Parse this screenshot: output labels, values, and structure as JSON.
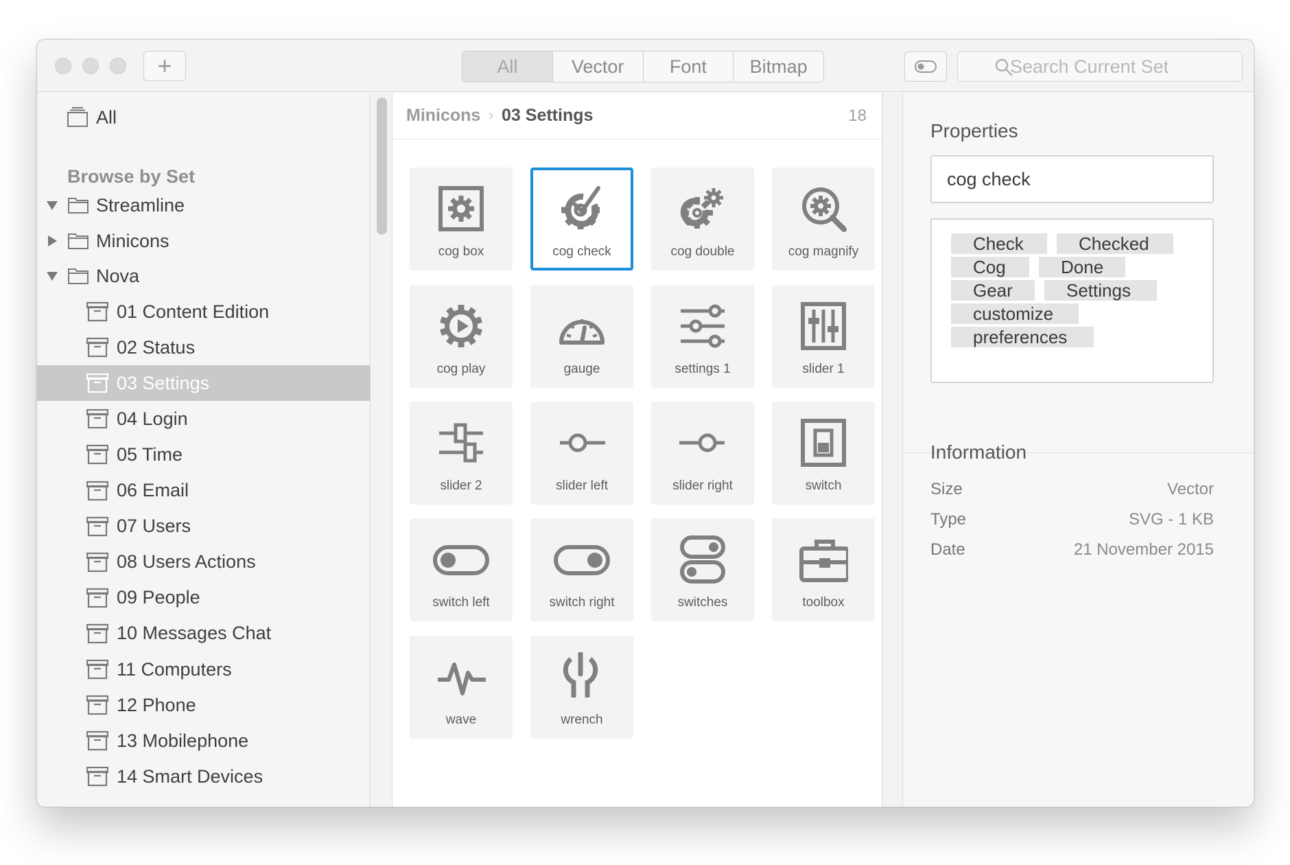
{
  "toolbar": {
    "add_label": "+",
    "filters": [
      "All",
      "Vector",
      "Font",
      "Bitmap"
    ],
    "active_filter": "All",
    "search_placeholder": "Search Current Set"
  },
  "sidebar": {
    "all_label": "All",
    "section_heading": "Browse by Set",
    "sets": [
      {
        "label": "Streamline",
        "expanded": true
      },
      {
        "label": "Minicons",
        "expanded": false
      },
      {
        "label": "Nova",
        "expanded": true
      }
    ],
    "nova_items": [
      "01 Content Edition",
      "02 Status",
      "03 Settings",
      "04 Login",
      "05 Time",
      "06 Email",
      "07 Users",
      "08 Users Actions",
      "09 People",
      "10 Messages Chat",
      "11 Computers",
      "12 Phone",
      "13 Mobilephone",
      "14 Smart Devices"
    ],
    "selected_item": "03 Settings"
  },
  "breadcrumb": {
    "parent": "Minicons",
    "separator": "›",
    "current": "03 Settings",
    "count": "18"
  },
  "icons": [
    {
      "label": "cog box",
      "icon": "cog-box-icon"
    },
    {
      "label": "cog check",
      "icon": "cog-check-icon"
    },
    {
      "label": "cog double",
      "icon": "cog-double-icon"
    },
    {
      "label": "cog magnify",
      "icon": "cog-magnify-icon"
    },
    {
      "label": "cog play",
      "icon": "cog-play-icon"
    },
    {
      "label": "gauge",
      "icon": "gauge-icon"
    },
    {
      "label": "settings 1",
      "icon": "settings-sliders-icon"
    },
    {
      "label": "slider 1",
      "icon": "slider-box-icon"
    },
    {
      "label": "slider 2",
      "icon": "slider-vertical-icon"
    },
    {
      "label": "slider left",
      "icon": "slider-left-icon"
    },
    {
      "label": "slider right",
      "icon": "slider-right-icon"
    },
    {
      "label": "switch",
      "icon": "switch-icon"
    },
    {
      "label": "switch left",
      "icon": "switch-left-icon"
    },
    {
      "label": "switch right",
      "icon": "switch-right-icon"
    },
    {
      "label": "switches",
      "icon": "switches-icon"
    },
    {
      "label": "toolbox",
      "icon": "toolbox-icon"
    },
    {
      "label": "wave",
      "icon": "wave-icon"
    },
    {
      "label": "wrench",
      "icon": "wrench-icon"
    }
  ],
  "selected_icon": "cog check",
  "properties": {
    "heading": "Properties",
    "name_value": "cog check",
    "tags": [
      "Check",
      "Checked",
      "Cog",
      "Done",
      "Gear",
      "Settings",
      "customize",
      "preferences"
    ]
  },
  "information": {
    "heading": "Information",
    "rows": [
      {
        "key": "Size",
        "value": "Vector"
      },
      {
        "key": "Type",
        "value": "SVG - 1 KB"
      },
      {
        "key": "Date",
        "value": "21 November 2015"
      }
    ]
  },
  "colors": {
    "accent": "#1c8fd8",
    "icon_gray": "#7a7a7a",
    "selected_row": "#c9c9c9"
  }
}
